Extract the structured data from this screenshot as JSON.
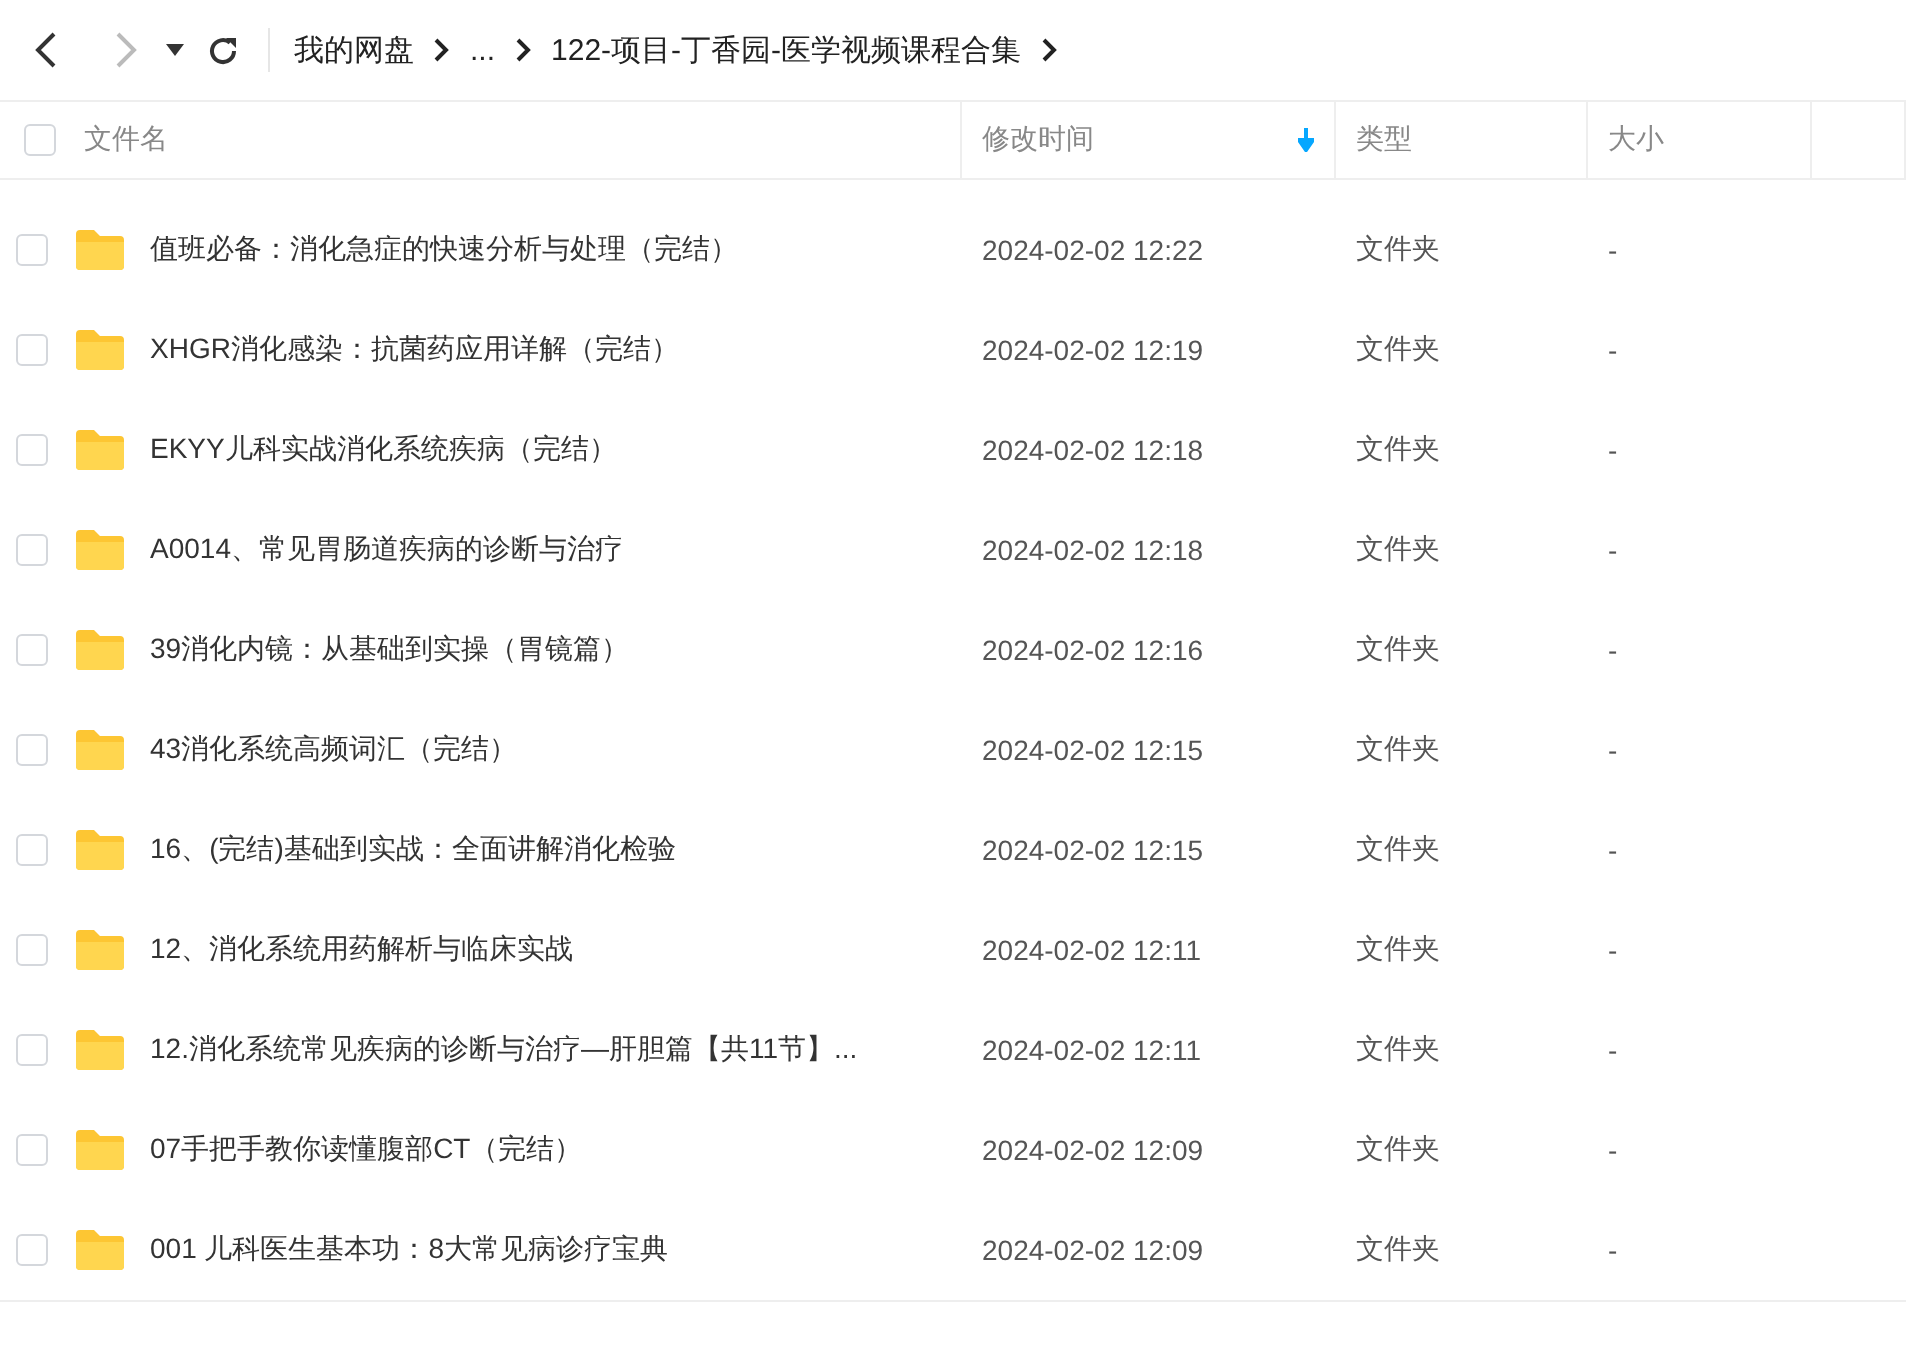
{
  "breadcrumb": [
    "我的网盘",
    "...",
    "122-项目-丁香园-医学视频课程合集"
  ],
  "table": {
    "select_all": {
      "checked": false
    },
    "columns": [
      {
        "label": "文件名",
        "sorted": false
      },
      {
        "label": "修改时间",
        "sorted": true
      },
      {
        "label": "类型",
        "sorted": false
      },
      {
        "label": "大小",
        "sorted": false
      }
    ],
    "rows": [
      {
        "checked": false,
        "name": "值班必备：消化急症的快速分析与处理（完结）",
        "modified": "2024-02-02 12:22",
        "type": "文件夹",
        "size": "-"
      },
      {
        "checked": false,
        "name": "XHGR消化感染：抗菌药应用详解（完结）",
        "modified": "2024-02-02 12:19",
        "type": "文件夹",
        "size": "-"
      },
      {
        "checked": false,
        "name": "EKYY儿科实战消化系统疾病（完结）",
        "modified": "2024-02-02 12:18",
        "type": "文件夹",
        "size": "-"
      },
      {
        "checked": false,
        "name": "A0014、常见胃肠道疾病的诊断与治疗",
        "modified": "2024-02-02 12:18",
        "type": "文件夹",
        "size": "-"
      },
      {
        "checked": false,
        "name": "39消化内镜：从基础到实操（胃镜篇）",
        "modified": "2024-02-02 12:16",
        "type": "文件夹",
        "size": "-"
      },
      {
        "checked": false,
        "name": "43消化系统高频词汇（完结）",
        "modified": "2024-02-02 12:15",
        "type": "文件夹",
        "size": "-"
      },
      {
        "checked": false,
        "name": "16、(完结)基础到实战：全面讲解消化检验",
        "modified": "2024-02-02 12:15",
        "type": "文件夹",
        "size": "-"
      },
      {
        "checked": false,
        "name": "12、消化系统用药解析与临床实战",
        "modified": "2024-02-02 12:11",
        "type": "文件夹",
        "size": "-"
      },
      {
        "checked": false,
        "name": "12.消化系统常见疾病的诊断与治疗—肝胆篇【共11节】...",
        "modified": "2024-02-02 12:11",
        "type": "文件夹",
        "size": "-"
      },
      {
        "checked": false,
        "name": "07手把手教你读懂腹部CT（完结）",
        "modified": "2024-02-02 12:09",
        "type": "文件夹",
        "size": "-"
      },
      {
        "checked": false,
        "name": "001 儿科医生基本功：8大常见病诊疗宝典",
        "modified": "2024-02-02 12:09",
        "type": "文件夹",
        "size": "-"
      }
    ]
  }
}
